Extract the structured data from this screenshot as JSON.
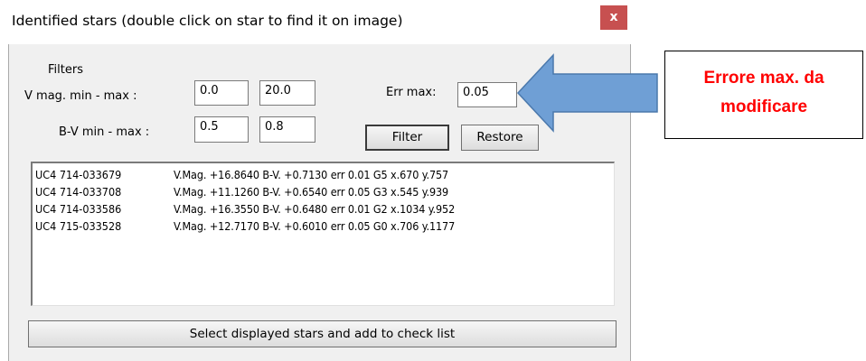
{
  "window": {
    "title": "Identified stars (double click on star to find it on image)",
    "close_label": "x"
  },
  "filters": {
    "section_label": "Filters",
    "vmag_label": "V mag. min - max :",
    "vmag_min": "0.0",
    "vmag_max": "20.0",
    "bv_label": "B-V min - max :",
    "bv_min": "0.5",
    "bv_max": "0.8",
    "err_label": "Err max:",
    "err_value": "0.05",
    "filter_button": "Filter",
    "restore_button": "Restore"
  },
  "stars": [
    {
      "id": "UC4 714-033679",
      "info": "V.Mag. +16.8640 B-V. +0.7130 err 0.01  G5 x.670 y.757"
    },
    {
      "id": "UC4 714-033708",
      "info": "V.Mag. +11.1260 B-V. +0.6540 err 0.05  G3 x.545 y.939"
    },
    {
      "id": "UC4 714-033586",
      "info": "V.Mag. +16.3550 B-V. +0.6480 err 0.01  G2 x.1034 y.952"
    },
    {
      "id": "UC4 715-033528",
      "info": "V.Mag. +12.7170 B-V. +0.6010 err 0.05  G0 x.706 y.1177"
    }
  ],
  "footer": {
    "add_button": "Select displayed stars and add to check list"
  },
  "annotation": {
    "line1": "Errore max. da",
    "line2": "modificare",
    "text_color": "#ff0000",
    "arrow_color": "#6f9fd5"
  }
}
